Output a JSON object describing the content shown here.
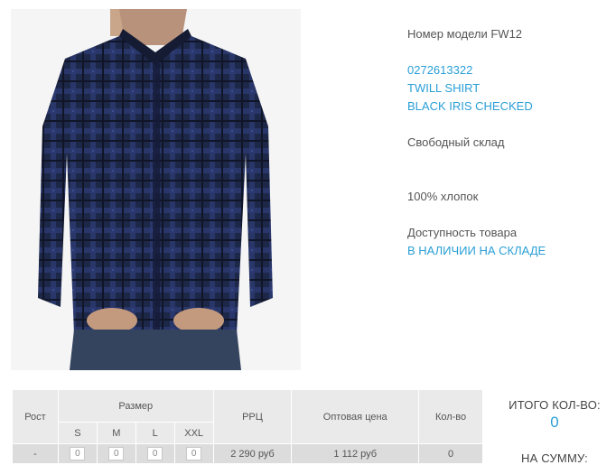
{
  "product": {
    "model_line": "Номер модели FW12",
    "sku": "0272613322",
    "name": "TWILL SHIRT",
    "color": "BLACK IRIS CHECKED",
    "warehouse": "Свободный склад",
    "material": "100% хлопок",
    "availability_label": "Доступность товара",
    "availability_value": "В НАЛИЧИИ НА СКЛАДЕ"
  },
  "size_table": {
    "headers": {
      "height": "Рост",
      "size": "Размер",
      "rrp": "РРЦ",
      "wholesale": "Оптовая цена",
      "quantity": "Кол-во"
    },
    "sizes": [
      "S",
      "M",
      "L",
      "XXL"
    ],
    "row": {
      "height": "-",
      "quantities": [
        "0",
        "0",
        "0",
        "0"
      ],
      "rrp": "2 290 руб",
      "wholesale": "1 112 руб",
      "quantity": "0"
    }
  },
  "totals": {
    "total_qty_label": "ИТОГО КОЛ-ВО:",
    "total_qty_value": "0",
    "total_sum_label": "НА СУММУ:"
  },
  "colors": {
    "accent": "#2a9fd6",
    "table_bg": "#eaeaea",
    "shirt": "#1f2a4f"
  }
}
